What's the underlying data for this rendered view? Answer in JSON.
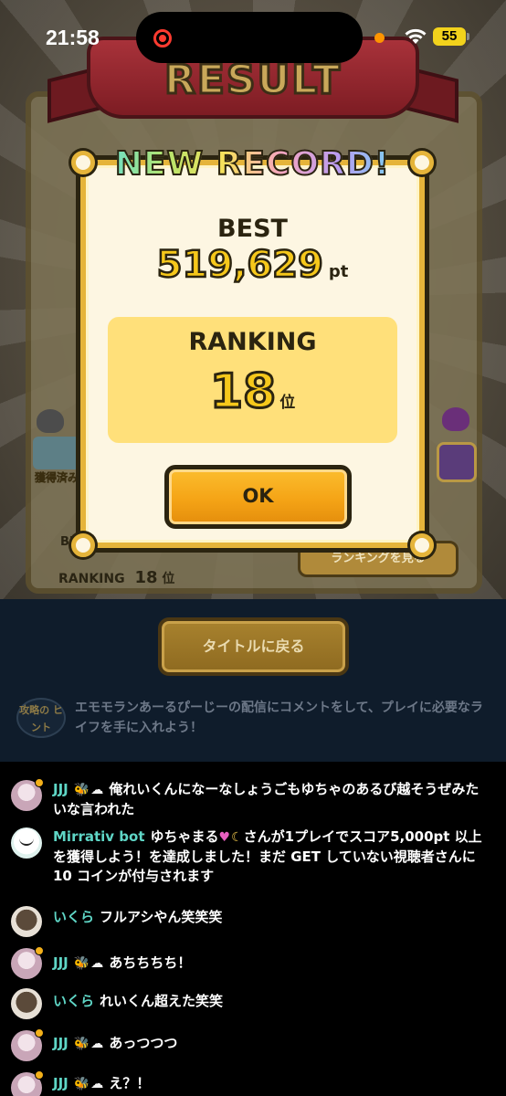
{
  "status_bar": {
    "time": "21:58",
    "battery": "55"
  },
  "game": {
    "banner_title": "RESULT",
    "owned_label": "獲得済み",
    "best_label_small": "BES",
    "ranking_label": "RANKING",
    "ranking_value": "18",
    "ranking_unit": "位",
    "ranking_button": "ランキングを見る",
    "title_button": "タイトルに戻る",
    "hint_badge": "攻略の ヒント",
    "hint_text": "エモモランあーるぴーじーの配信にコメントをして、プレイに必要なライフを手に入れよう！"
  },
  "modal": {
    "heading": "NEW RECORD!",
    "best_label": "BEST",
    "best_value": "519,629",
    "best_unit": "pt",
    "ranking_label": "RANKING",
    "ranking_value": "18",
    "ranking_unit": "位",
    "ok_label": "OK"
  },
  "chat": {
    "messages": [
      {
        "user": "JJJ",
        "icons": [
          "bee-icon",
          "cloud-icon"
        ],
        "text": "俺れいくんになーなしょうごもゆちゃのあるび越そうぜみたいな言われた"
      },
      {
        "user": "Mirrativ bot",
        "text_a": "ゆちゃまる",
        "text_b": "さんが1プレイでスコア5,000pt 以上を獲得しよう！を達成しました！まだ GET していない視聴者さんに 10 コインが付与されます"
      },
      {
        "user": "いくら",
        "text": "フルアシやん笑笑笑"
      },
      {
        "user": "JJJ",
        "icons": [
          "bee-icon",
          "cloud-icon"
        ],
        "text": "あちちちち！"
      },
      {
        "user": "いくら",
        "text": "れいくん超えた笑笑"
      },
      {
        "user": "JJJ",
        "icons": [
          "bee-icon",
          "cloud-icon"
        ],
        "text": "あっつつつ"
      },
      {
        "user": "JJJ",
        "icons": [
          "bee-icon",
          "cloud-icon"
        ],
        "text": "え？！"
      }
    ]
  },
  "colors": {
    "gold": "#f6c81b",
    "frame": "#e5b43a",
    "ok_button": "#f5a416",
    "chat_username": "#5fd6c6",
    "panel_bg": "#0f1c2b"
  }
}
